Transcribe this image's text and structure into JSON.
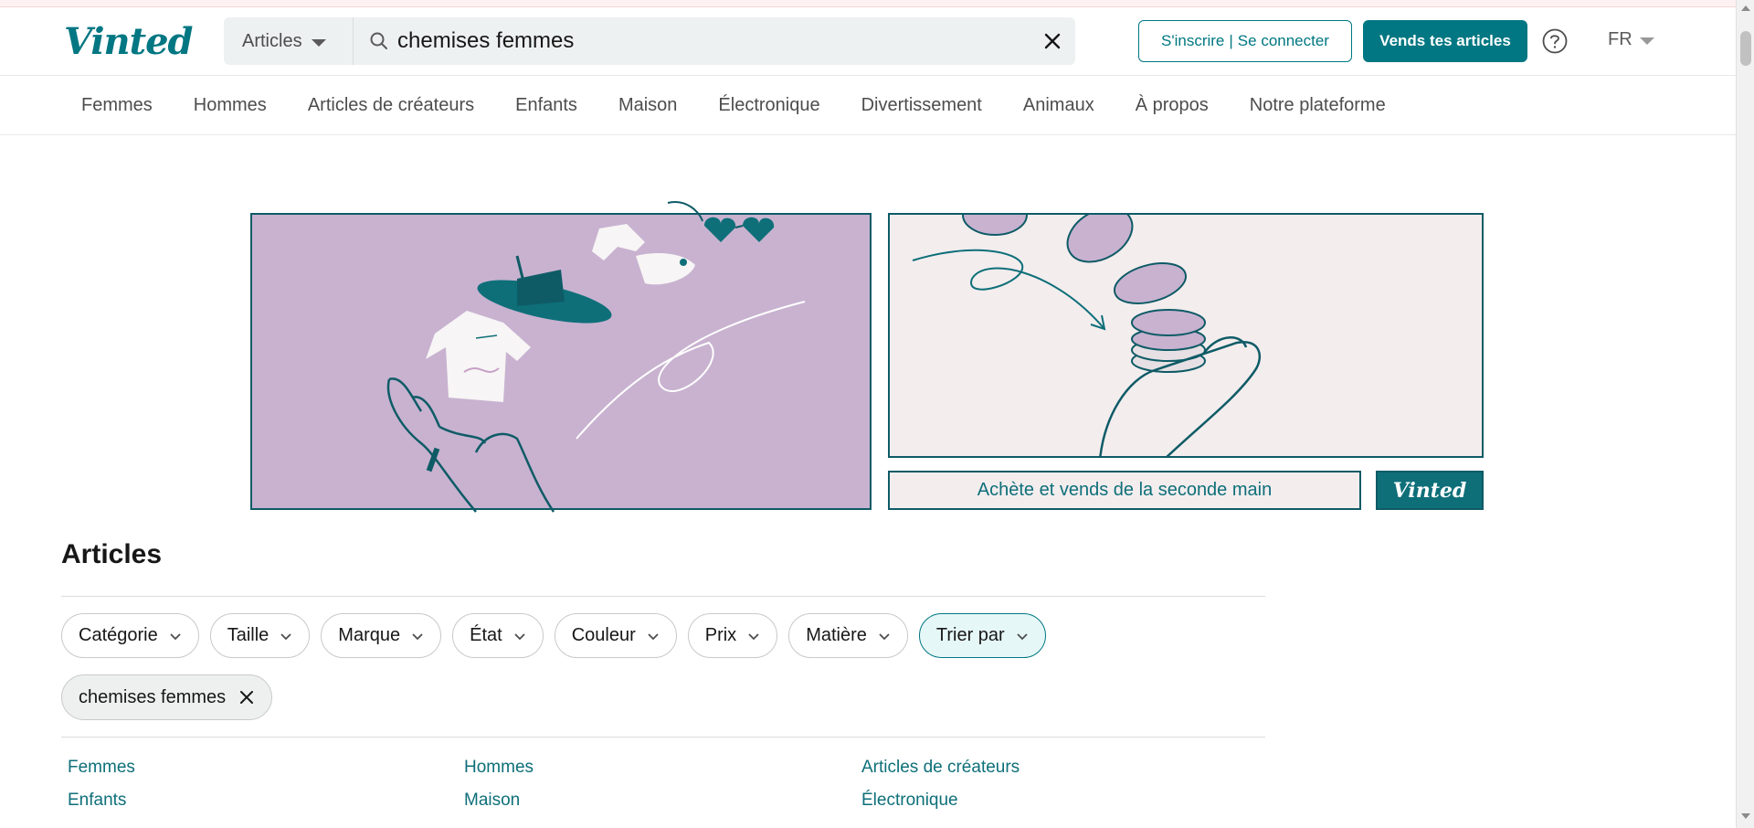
{
  "header": {
    "logo": "Vinted",
    "search_type": "Articles",
    "search_value": "chemises femmes",
    "auth_signup": "S'inscrire",
    "auth_login": "Se connecter",
    "sell_button": "Vends tes articles",
    "language": "FR"
  },
  "nav": {
    "items": [
      "Femmes",
      "Hommes",
      "Articles de créateurs",
      "Enfants",
      "Maison",
      "Électronique",
      "Divertissement",
      "Animaux",
      "À propos",
      "Notre plateforme"
    ]
  },
  "banner": {
    "tagline": "Achète et vends de la seconde main",
    "logo": "Vinted"
  },
  "main": {
    "title": "Articles",
    "filters": [
      "Catégorie",
      "Taille",
      "Marque",
      "État",
      "Couleur",
      "Prix",
      "Matière",
      "Trier par"
    ],
    "active_filter": "Trier par",
    "applied_tag": "chemises femmes",
    "category_links": [
      "Femmes",
      "Hommes",
      "Articles de créateurs",
      "Enfants",
      "Maison",
      "Électronique"
    ]
  },
  "colors": {
    "brand": "#007782",
    "banner_purple": "#c8b2d0",
    "banner_light": "#f3edee",
    "outline_dark_teal": "#0e5b66"
  },
  "icons": [
    "search-icon",
    "close-icon",
    "help-icon",
    "chevron-down-icon",
    "caret-down-icon"
  ]
}
